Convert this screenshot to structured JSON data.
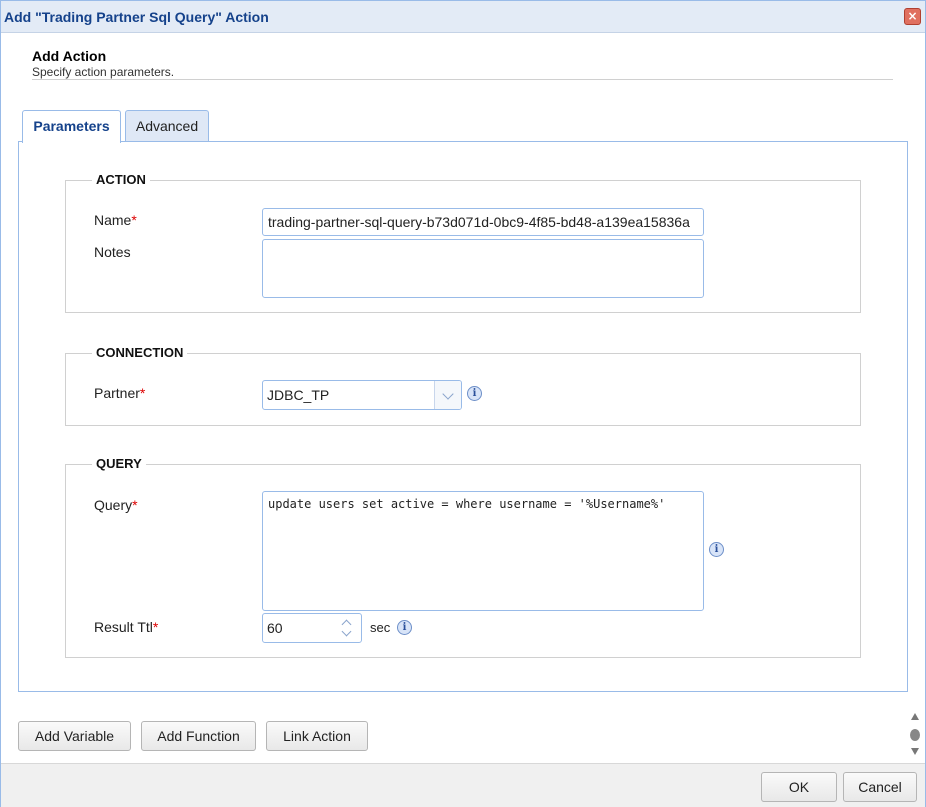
{
  "window": {
    "title": "Add \"Trading Partner Sql Query\" Action",
    "close_symbol": "×"
  },
  "header": {
    "title": "Add Action",
    "subtitle": "Specify action parameters."
  },
  "tabs": [
    {
      "label": "Parameters",
      "active": true
    },
    {
      "label": "Advanced",
      "active": false
    }
  ],
  "sections": {
    "action": {
      "legend": "ACTION",
      "name_label": "Name",
      "name_value": "trading-partner-sql-query-b73d071d-0bc9-4f85-bd48-a139ea15836a",
      "notes_label": "Notes",
      "notes_value": ""
    },
    "connection": {
      "legend": "CONNECTION",
      "partner_label": "Partner",
      "partner_value": "JDBC_TP"
    },
    "query": {
      "legend": "QUERY",
      "query_label": "Query",
      "query_value": "update users set active = where username = '%Username%'",
      "result_ttl_label": "Result Ttl",
      "result_ttl_value": "60",
      "result_ttl_unit": "sec"
    }
  },
  "required_marker": "*",
  "info_symbol": "i",
  "bottom_buttons": {
    "add_variable": "Add Variable",
    "add_function": "Add Function",
    "link_action": "Link Action"
  },
  "footer": {
    "ok": "OK",
    "cancel": "Cancel"
  },
  "colors": {
    "title_text": "#15428b",
    "border_blue": "#99bbe8",
    "required": "#dd0000"
  }
}
